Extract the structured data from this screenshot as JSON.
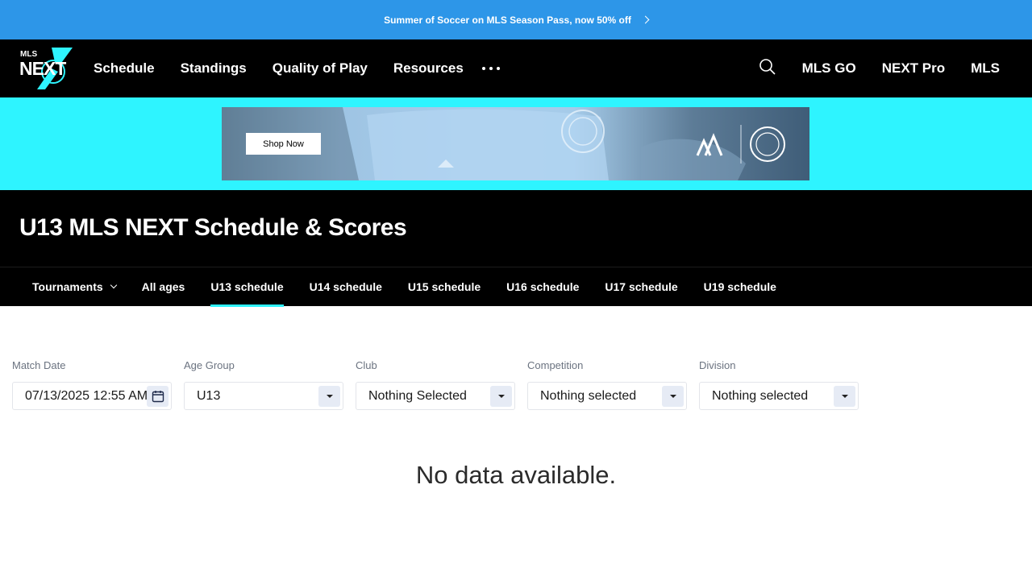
{
  "promo": {
    "text": "Summer of Soccer on MLS Season Pass, now 50% off",
    "icon": "chevron-right-icon"
  },
  "nav": {
    "logo": {
      "small": "MLS",
      "big": "NEXT"
    },
    "links": [
      "Schedule",
      "Standings",
      "Quality of Play",
      "Resources"
    ],
    "more_icon": "more-dots-icon",
    "search_icon": "search-icon",
    "right_links": [
      "MLS GO",
      "NEXT Pro",
      "MLS"
    ]
  },
  "ad": {
    "button": "Shop Now",
    "band_color": "#2ef4ff"
  },
  "page": {
    "title": "U13 MLS NEXT Schedule & Scores"
  },
  "tabs": [
    {
      "label": "Tournaments",
      "dropdown": true
    },
    {
      "label": "All ages"
    },
    {
      "label": "U13 schedule",
      "active": true
    },
    {
      "label": "U14 schedule"
    },
    {
      "label": "U15 schedule"
    },
    {
      "label": "U16 schedule"
    },
    {
      "label": "U17 schedule"
    },
    {
      "label": "U19 schedule"
    }
  ],
  "filters": {
    "match_date": {
      "label": "Match Date",
      "value": "07/13/2025 12:55 AM",
      "icon": "calendar-icon"
    },
    "age_group": {
      "label": "Age Group",
      "value": "U13"
    },
    "club": {
      "label": "Club",
      "value": "Nothing Selected"
    },
    "competition": {
      "label": "Competition",
      "value": "Nothing selected"
    },
    "division": {
      "label": "Division",
      "value": "Nothing selected"
    }
  },
  "empty_message": "No data available.",
  "colors": {
    "promo": "#2d96e8",
    "accent": "#2ef4ff",
    "nav_bg": "#000000"
  }
}
